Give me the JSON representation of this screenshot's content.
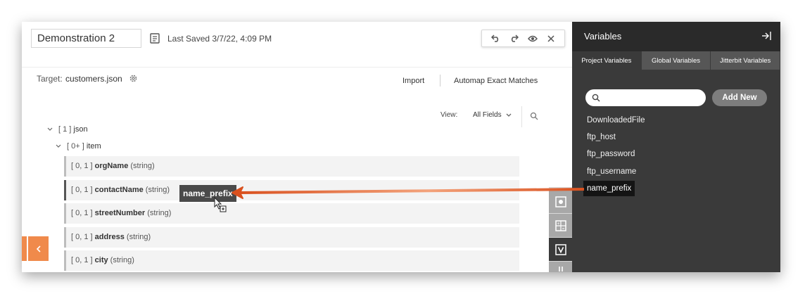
{
  "header": {
    "title_value": "Demonstration 2",
    "last_saved": "Last Saved 3/7/22, 4:09 PM"
  },
  "target": {
    "label": "Target:",
    "file": "customers.json",
    "import_label": "Import",
    "automap_label": "Automap Exact Matches"
  },
  "view": {
    "label": "View:",
    "selected": "All Fields"
  },
  "tree": {
    "root_bracket": "[ 1 ]",
    "root_name": "json",
    "item_bracket": "[ 0+ ]",
    "item_name": "item",
    "fields": [
      {
        "card": "[ 0, 1 ]",
        "name": "orgName",
        "type": "(string)"
      },
      {
        "card": "[ 0, 1 ]",
        "name": "contactName",
        "type": "(string)"
      },
      {
        "card": "[ 0, 1 ]",
        "name": "streetNumber",
        "type": "(string)"
      },
      {
        "card": "[ 0, 1 ]",
        "name": "address",
        "type": "(string)"
      },
      {
        "card": "[ 0, 1 ]",
        "name": "city",
        "type": "(string)"
      }
    ]
  },
  "drag": {
    "token": "name_prefix"
  },
  "panel": {
    "title": "Variables",
    "tabs": [
      "Project Variables",
      "Global Variables",
      "Jitterbit Variables"
    ],
    "search_placeholder": "",
    "add_new": "Add New",
    "variables": [
      "DownloadedFile",
      "ftp_host",
      "ftp_password",
      "ftp_username",
      "name_prefix"
    ]
  },
  "colors": {
    "accent": "#f08a4b",
    "arrow": "#d9511f",
    "panel_bg": "#3a3a3a"
  }
}
